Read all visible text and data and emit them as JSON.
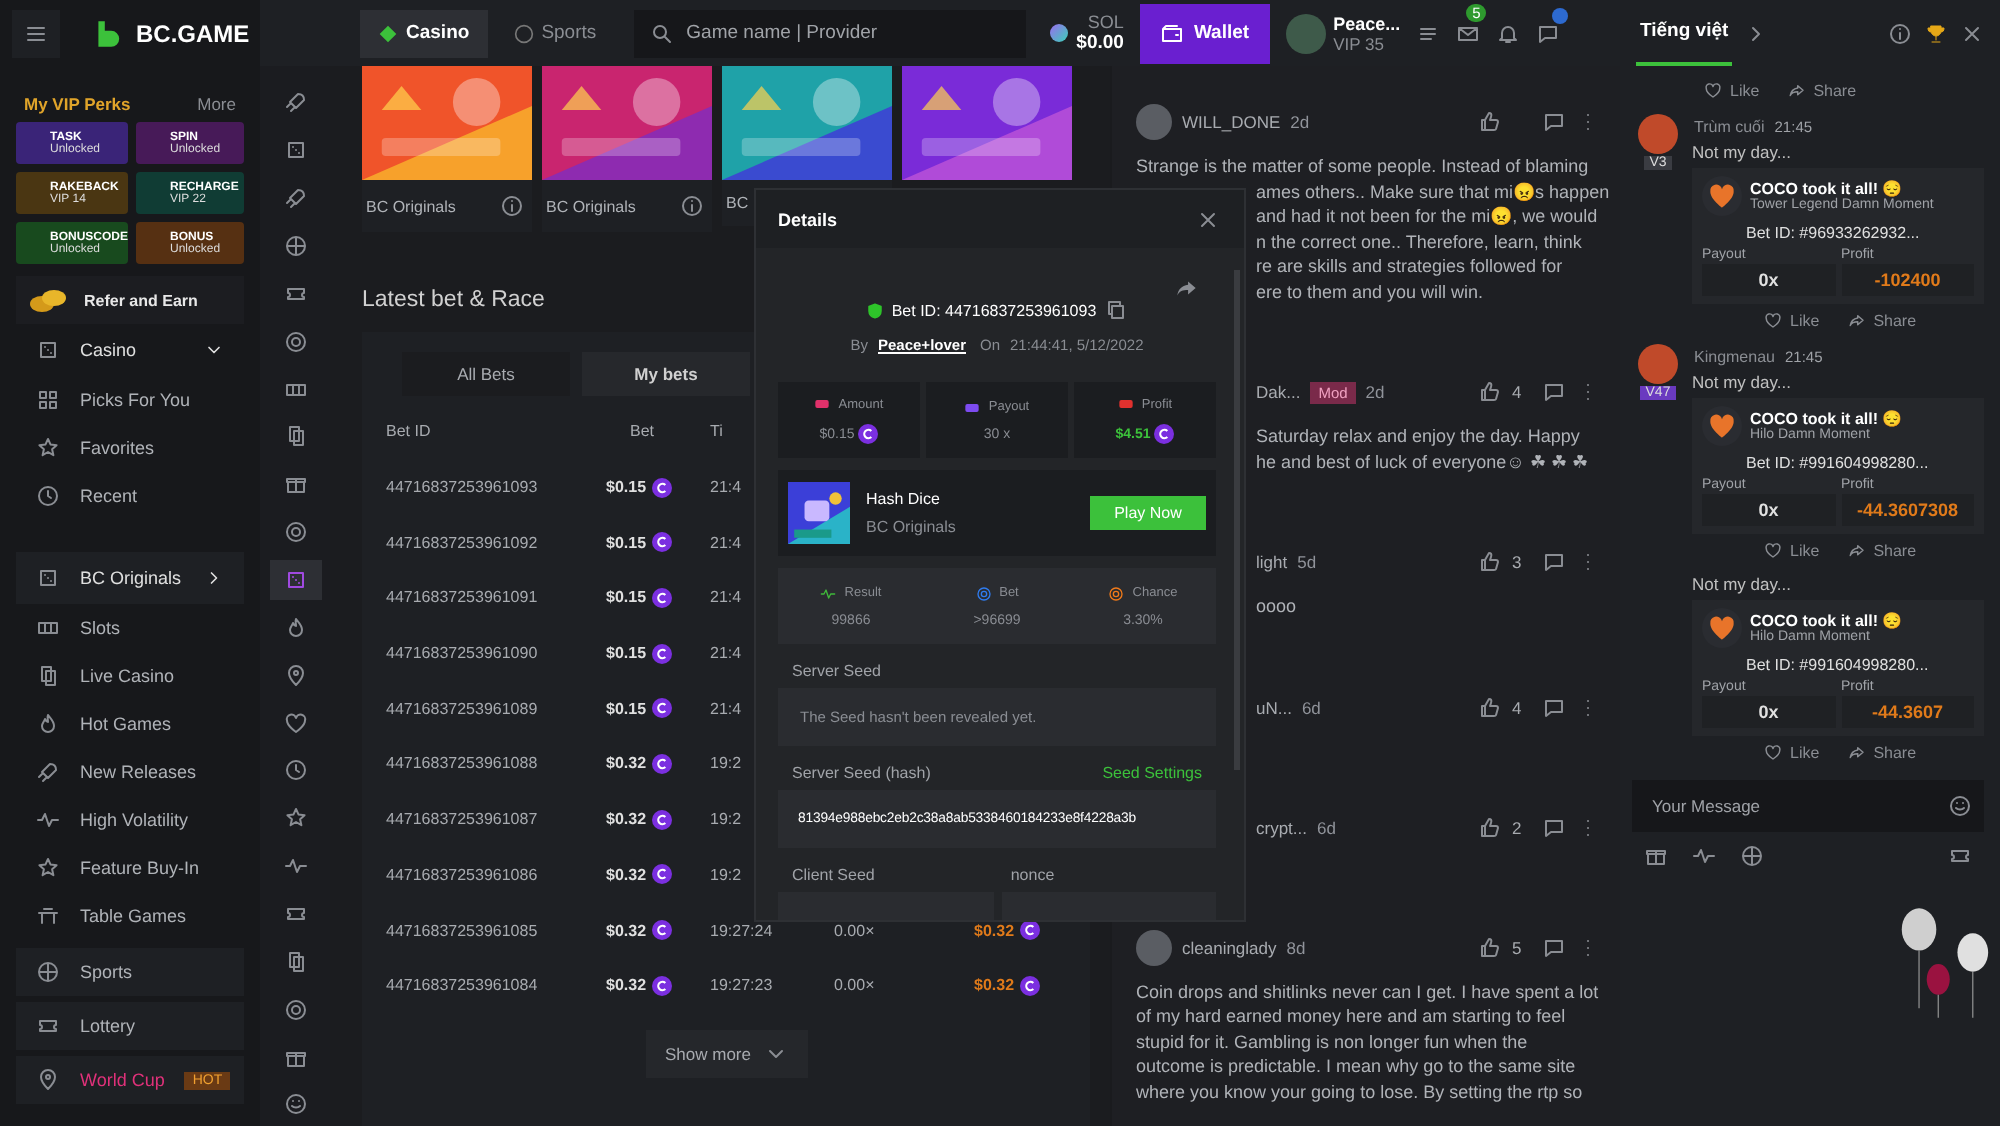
{
  "sidebar": {
    "logo": "BC.GAME",
    "vip_title": "My VIP Perks",
    "vip_more": "More",
    "perks": [
      {
        "name": "TASK",
        "status": "Unlocked",
        "color": "#3a2478"
      },
      {
        "name": "SPIN",
        "status": "Unlocked",
        "color": "#471a58"
      },
      {
        "name": "RAKEBACK",
        "status": "VIP 14",
        "color": "#4a3612"
      },
      {
        "name": "RECHARGE",
        "status": "VIP 22",
        "color": "#103c34"
      },
      {
        "name": "BONUSCODE",
        "status": "Unlocked",
        "color": "#184a1e"
      },
      {
        "name": "BONUS",
        "status": "Unlocked",
        "color": "#563012"
      }
    ],
    "refer": "Refer and Earn",
    "nav": [
      {
        "label": "Casino",
        "kind": "section",
        "expanded": true
      },
      {
        "label": "Picks For You",
        "kind": "item"
      },
      {
        "label": "Favorites",
        "kind": "item"
      },
      {
        "label": "Recent",
        "kind": "item"
      },
      {
        "label": "BC Originals",
        "kind": "section",
        "expanded": false
      },
      {
        "label": "Slots",
        "kind": "item"
      },
      {
        "label": "Live Casino",
        "kind": "item"
      },
      {
        "label": "Hot Games",
        "kind": "item"
      },
      {
        "label": "New Releases",
        "kind": "item"
      },
      {
        "label": "High Volatility",
        "kind": "item"
      },
      {
        "label": "Feature Buy-In",
        "kind": "item"
      },
      {
        "label": "Table Games",
        "kind": "item"
      },
      {
        "label": "Sports",
        "kind": "block"
      },
      {
        "label": "Lottery",
        "kind": "block"
      },
      {
        "label": "World Cup",
        "kind": "block",
        "badge": "HOT"
      }
    ]
  },
  "rail": [
    {
      "selected": false
    },
    {
      "selected": false
    },
    {
      "selected": false
    },
    {
      "selected": false
    },
    {
      "selected": false
    },
    {
      "selected": false
    },
    {
      "selected": false
    },
    {
      "selected": false
    },
    {
      "selected": false
    },
    {
      "selected": false
    },
    {
      "selected": true
    },
    {
      "selected": false
    },
    {
      "selected": false
    },
    {
      "selected": false
    },
    {
      "selected": false
    },
    {
      "selected": false
    },
    {
      "selected": false
    },
    {
      "selected": false
    },
    {
      "selected": false
    },
    {
      "selected": false
    },
    {
      "selected": false
    },
    {
      "selected": false
    }
  ],
  "topbar": {
    "tabs": [
      {
        "label": "Casino",
        "selected": true
      },
      {
        "label": "Sports",
        "selected": false
      }
    ],
    "search": {
      "placeholder": "Game name | Provider"
    },
    "currency": "SOL",
    "balance": "$0.00",
    "wallet": "Wallet",
    "user": "Peace...",
    "vip": "VIP 35",
    "mail_count": "5"
  },
  "games": [
    {
      "kind": "picture",
      "provider": "BC Originals",
      "info": true
    },
    {
      "kind": "picture",
      "provider": "BC Originals",
      "info": true
    },
    {
      "kind": "picture",
      "provider": "BC",
      "info": false
    },
    {
      "kind": "picture"
    }
  ],
  "bets": {
    "title": "Latest bet & Race",
    "tabs": [
      {
        "label": "All Bets",
        "selected": false
      },
      {
        "label": "My bets",
        "selected": true
      }
    ],
    "columns": [
      "Bet ID",
      "Bet",
      "Ti"
    ],
    "rows": [
      {
        "id": "44716837253961093",
        "bet": "$0.15",
        "time": "21:4"
      },
      {
        "id": "44716837253961092",
        "bet": "$0.15",
        "time": "21:4"
      },
      {
        "id": "44716837253961091",
        "bet": "$0.15",
        "time": "21:4"
      },
      {
        "id": "44716837253961090",
        "bet": "$0.15",
        "time": "21:4"
      },
      {
        "id": "44716837253961089",
        "bet": "$0.15",
        "time": "21:4"
      },
      {
        "id": "44716837253961088",
        "bet": "$0.32",
        "time": "19:2"
      },
      {
        "id": "44716837253961087",
        "bet": "$0.32",
        "time": "19:2"
      },
      {
        "id": "44716837253961086",
        "bet": "$0.32",
        "time": "19:2"
      },
      {
        "id": "44716837253961085",
        "bet": "$0.32",
        "time": "19:27:24",
        "payout": "0.00×",
        "profit": "$0.32"
      },
      {
        "id": "44716837253961084",
        "bet": "$0.32",
        "time": "19:27:23",
        "payout": "0.00×",
        "profit": "$0.32"
      }
    ],
    "show_more": "Show more"
  },
  "details": {
    "title": "Details",
    "bet_id": "Bet ID: 44716837253961093",
    "by": "By",
    "user": "Peace+lover",
    "on": "On",
    "date": "21:44:41, 5/12/2022",
    "stats": [
      {
        "label": "Amount",
        "value": "$0.15",
        "positive": false
      },
      {
        "label": "Payout",
        "value": "30 x"
      },
      {
        "label": "Profit",
        "value": "$4.51",
        "positive": true
      }
    ],
    "game": {
      "name": "Hash Dice",
      "provider": "BC Originals",
      "play": "Play Now"
    },
    "result": [
      {
        "label": "Result",
        "value": "99866"
      },
      {
        "label": "Bet",
        "value": ">96699"
      },
      {
        "label": "Chance",
        "value": "3.30%"
      }
    ],
    "server_seed_label": "Server Seed",
    "server_seed": "The Seed hasn't been revealed yet.",
    "hash_label": "Server Seed (hash)",
    "seed_settings": "Seed Settings",
    "hash": "81394e988ebc2eb2c38a8ab5338460184233e8f4228a3b",
    "client_label": "Client Seed",
    "nonce_label": "nonce"
  },
  "comments": [
    {
      "kind": "full",
      "user": "WILL_DONE",
      "time": "2d",
      "lines": [
        "Strange is the matter of some people. Instead of blaming"
      ],
      "clipped_lines": [
        "ames others.. Make sure that mi😠s happen",
        "and had it not been for the mi😠, we would",
        "n the correct one.. Therefore, learn, think",
        "re are skills and strategies followed for",
        "ere to them and you will win."
      ]
    },
    {
      "kind": "clipped",
      "user": "Dak...",
      "badge": "Mod",
      "time": "2d",
      "likes": "4",
      "clipped_lines": [
        "Saturday relax and enjoy the day. Happy",
        "he and best of luck of everyone☺ ☘ ☘ ☘"
      ]
    },
    {
      "kind": "clipped",
      "user": "light",
      "time": "5d",
      "likes": "3",
      "clipped_lines": [
        "oooo"
      ]
    },
    {
      "kind": "clipped",
      "user": "uN...",
      "time": "6d",
      "likes": "4"
    },
    {
      "kind": "clipped",
      "user": "crypt...",
      "time": "6d",
      "likes": "2"
    },
    {
      "kind": "full",
      "user": "cleaninglady",
      "time": "8d",
      "likes": "5",
      "lines": [
        "Coin drops and shitlinks never can I get. I have spent a lot",
        "of my hard earned money here and am starting to feel",
        "stupid for it. Gambling is non longer fun when the",
        "outcome is predictable. I mean why go to the same site",
        "where you know your going to lose. By setting the rtp so"
      ]
    }
  ],
  "right": {
    "title": "Tiếng việt",
    "top_like": "Like",
    "top_share": "Share",
    "posts": [
      {
        "user": "Trùm cuối",
        "time": "21:45",
        "vip": "V3",
        "text": "Not my day...",
        "card_title": "COCO took it all! 😔",
        "card_sub": "Tower Legend Damn Moment",
        "bet_id": "Bet ID: #96933262932...",
        "payout_label": "Payout",
        "payout": "0x",
        "profit_label": "Profit",
        "profit": "-102400",
        "like": "Like",
        "share": "Share"
      },
      {
        "user": "Kingmenau",
        "time": "21:45",
        "vip": "V47",
        "text": "Not my day...",
        "card_title": "COCO took it all! 😔",
        "card_sub": "Hilo Damn Moment",
        "bet_id": "Bet ID: #991604998280...",
        "payout_label": "Payout",
        "payout": "0x",
        "profit_label": "Profit",
        "profit": "-44.3607308",
        "like": "Like",
        "share": "Share"
      },
      {
        "text": "Not my day...",
        "card_title": "COCO took it all! 😔",
        "card_sub": "Hilo Damn Moment",
        "bet_id": "Bet ID: #991604998280...",
        "payout_label": "Payout",
        "payout": "0x",
        "profit_label": "Profit",
        "profit": "-44.3607",
        "like": "Like",
        "share": "Share"
      }
    ],
    "message_placeholder": "Your Message"
  }
}
